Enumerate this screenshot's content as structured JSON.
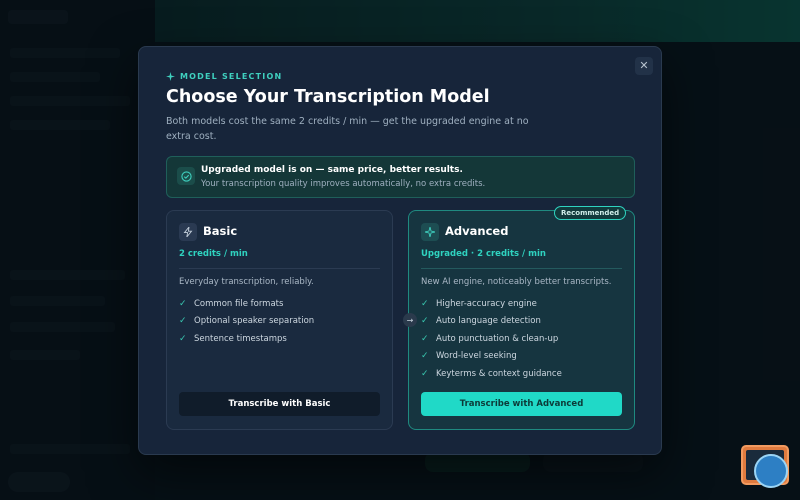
{
  "modal": {
    "eyebrow": "MODEL SELECTION",
    "title": "Choose Your Transcription Model",
    "subtitle": "Both models cost the same 2 credits / min — get the upgraded engine at no extra cost.",
    "close_icon": "close-icon",
    "banner": {
      "icon": "check-circle-icon",
      "title": "Upgraded model is on — same price, better results.",
      "subtitle": "Your transcription quality improves automatically, no extra credits."
    },
    "badge": "Recommended",
    "cards": {
      "basic": {
        "icon": "bolt-icon",
        "name": "Basic",
        "price": "2 credits / min",
        "description": "Everyday transcription, reliably.",
        "features": [
          "Common file formats",
          "Optional speaker separation",
          "Sentence timestamps"
        ],
        "cta": "Transcribe with Basic"
      },
      "advanced": {
        "icon": "sparkle-icon",
        "name": "Advanced",
        "price": "Upgraded · 2 credits / min",
        "description": "New AI engine, noticeably better transcripts.",
        "features": [
          "Higher-accuracy engine",
          "Auto language detection",
          "Auto punctuation & clean-up",
          "Word-level seeking",
          "Keyterms & context guidance"
        ],
        "cta": "Transcribe with Advanced"
      }
    }
  },
  "colors": {
    "accent": "#20d9c7",
    "modal_bg": "#17253a",
    "advanced_border": "#1f8a80"
  }
}
